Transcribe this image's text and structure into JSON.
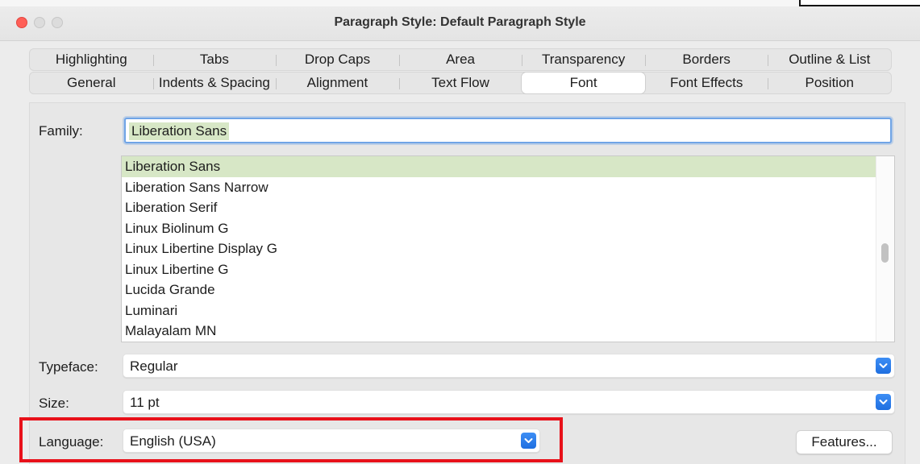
{
  "window": {
    "title": "Paragraph Style: Default Paragraph Style"
  },
  "tabs": {
    "row1": [
      "Highlighting",
      "Tabs",
      "Drop Caps",
      "Area",
      "Transparency",
      "Borders",
      "Outline & List"
    ],
    "row2": [
      "General",
      "Indents & Spacing",
      "Alignment",
      "Text Flow",
      "Font",
      "Font Effects",
      "Position"
    ],
    "active": "Font"
  },
  "font": {
    "family_label": "Family:",
    "family_value": "Liberation Sans",
    "family_list": [
      "Liberation Sans",
      "Liberation Sans Narrow",
      "Liberation Serif",
      "Linux Biolinum G",
      "Linux Libertine Display G",
      "Linux Libertine G",
      "Lucida Grande",
      "Luminari",
      "Malayalam MN"
    ],
    "selected_index": 0,
    "typeface_label": "Typeface:",
    "typeface_value": "Regular",
    "size_label": "Size:",
    "size_value": "11 pt",
    "language_label": "Language:",
    "language_value": "English (USA)",
    "features_button": "Features..."
  },
  "colors": {
    "selection": "#d7e7c6",
    "accent": "#1f6fe0",
    "highlight_box": "#e8111a"
  }
}
